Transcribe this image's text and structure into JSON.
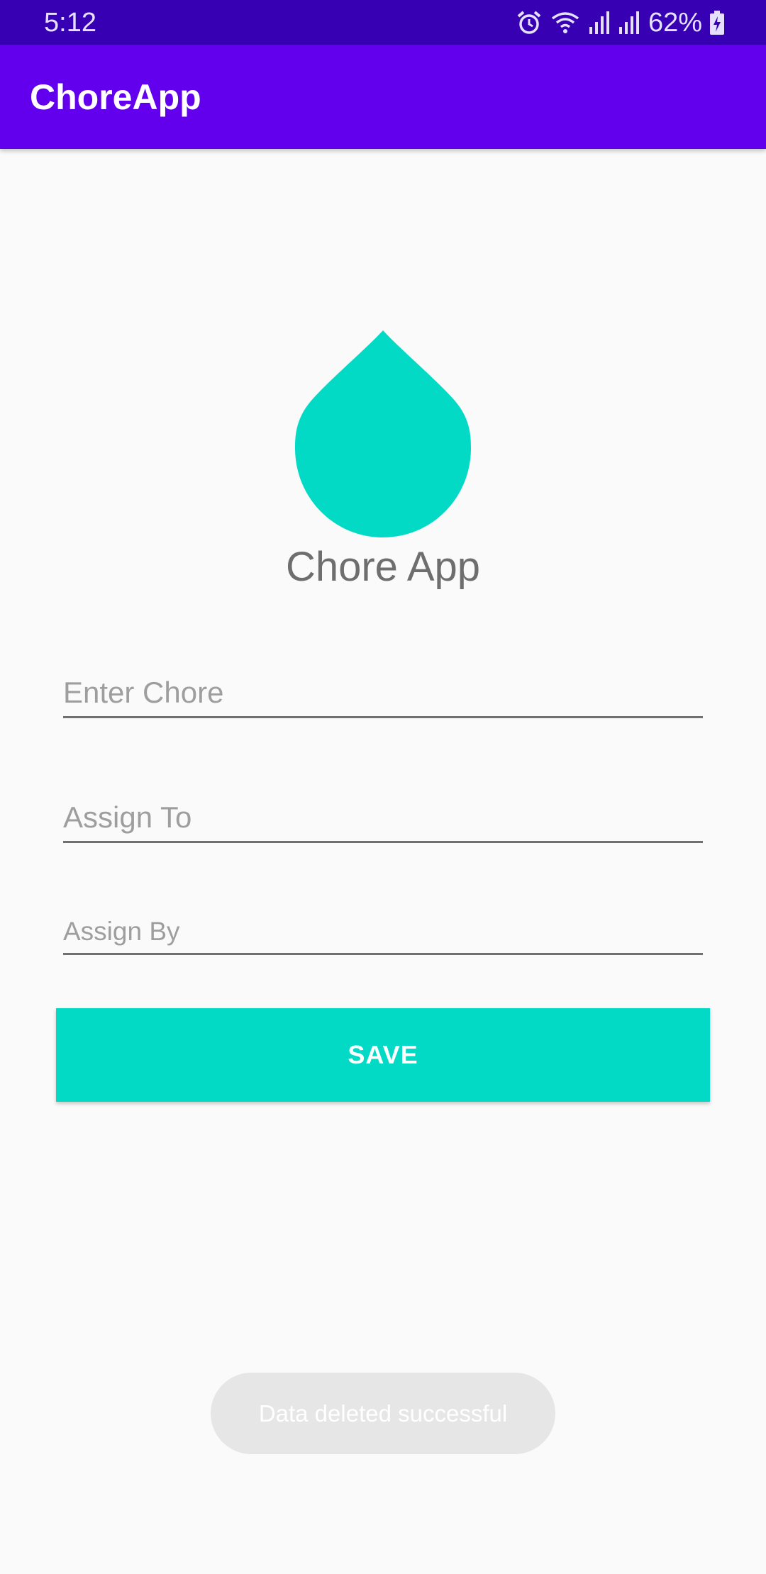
{
  "status_bar": {
    "time": "5:12",
    "battery_percent": "62%",
    "icons": [
      "alarm-icon",
      "wifi-icon",
      "signal-icon",
      "signal-icon",
      "battery-charging-icon"
    ],
    "background_color": "#3700B3"
  },
  "app_bar": {
    "title": "ChoreApp",
    "background_color": "#6200EE"
  },
  "logo": {
    "icon": "water-drop-icon",
    "color": "#03DAC5",
    "title": "Chore App"
  },
  "form": {
    "chore_placeholder": "Enter Chore",
    "assign_to_placeholder": "Assign To",
    "assign_by_placeholder": "Assign By",
    "chore_value": "",
    "assign_to_value": "",
    "assign_by_value": ""
  },
  "save_button": {
    "label": "SAVE",
    "color": "#03DAC5"
  },
  "toast": {
    "message": "Data deleted successful"
  }
}
